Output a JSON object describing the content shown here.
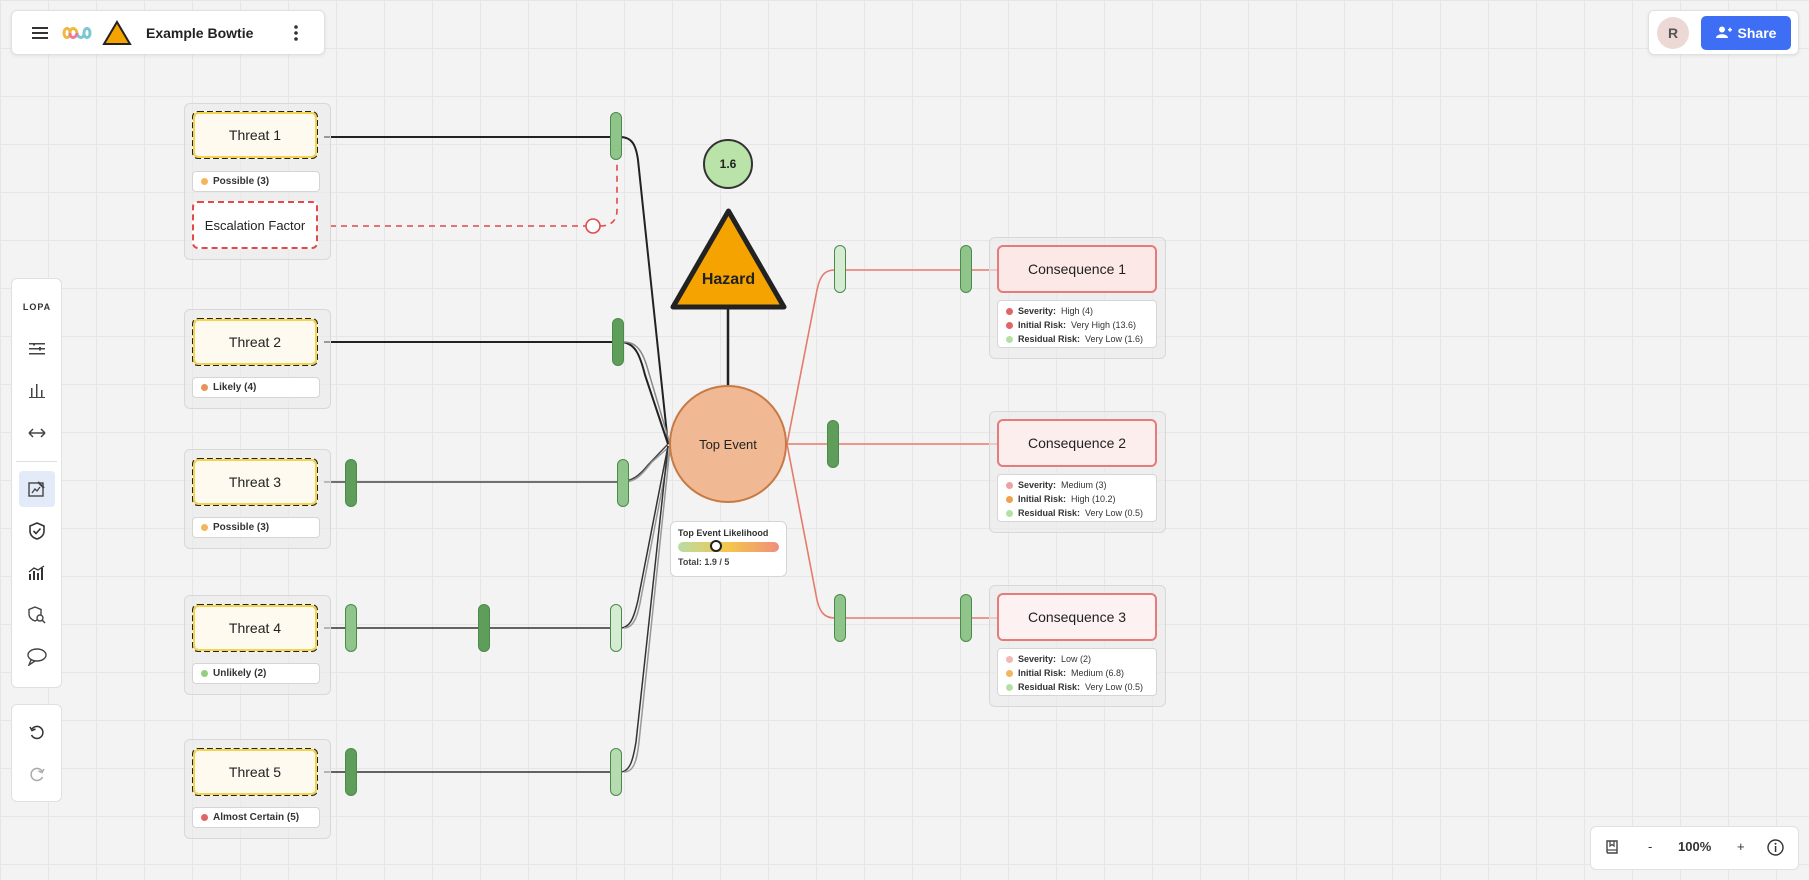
{
  "topbar": {
    "title": "Example Bowtie"
  },
  "user": {
    "initial": "R"
  },
  "share": {
    "label": "Share"
  },
  "toolbar": {
    "lopa_label": "LOPA"
  },
  "zoom": {
    "minus": "-",
    "level": "100%",
    "plus": "+"
  },
  "hazard": {
    "label": "Hazard"
  },
  "score": {
    "value": "1.6"
  },
  "top_event": {
    "label": "Top Event",
    "likelihood_title": "Top Event Likelihood",
    "likelihood_total": "Total: 1.9 / 5",
    "likelihood_value": 1.9,
    "likelihood_max": 5
  },
  "threats": [
    {
      "label": "Threat 1",
      "likelihood": "Possible (3)",
      "color": "#f4b65b"
    },
    {
      "label": "Threat 2",
      "likelihood": "Likely (4)",
      "color": "#e8935a"
    },
    {
      "label": "Threat 3",
      "likelihood": "Possible (3)",
      "color": "#f4b65b"
    },
    {
      "label": "Threat 4",
      "likelihood": "Unlikely (2)",
      "color": "#93cf7e"
    },
    {
      "label": "Threat 5",
      "likelihood": "Almost Certain (5)",
      "color": "#e06565"
    }
  ],
  "escalation": {
    "label": "Escalation Factor"
  },
  "consequences": [
    {
      "label": "Consequence 1",
      "severity_label": "Severity:",
      "severity": "High (4)",
      "severity_color": "#e06565",
      "initial_label": "Initial Risk:",
      "initial": "Very High (13.6)",
      "initial_color": "#e06565",
      "residual_label": "Residual Risk:",
      "residual": "Very Low (1.6)",
      "residual_color": "#b5e0a4"
    },
    {
      "label": "Consequence 2",
      "severity_label": "Severity:",
      "severity": "Medium (3)",
      "severity_color": "#f0a0a0",
      "initial_label": "Initial Risk:",
      "initial": "High (10.2)",
      "initial_color": "#f0a14a",
      "residual_label": "Residual Risk:",
      "residual": "Very Low (0.5)",
      "residual_color": "#b5e0a4"
    },
    {
      "label": "Consequence 3",
      "severity_label": "Severity:",
      "severity": "Low (2)",
      "severity_color": "#f4b6b6",
      "initial_label": "Initial Risk:",
      "initial": "Medium (6.8)",
      "initial_color": "#f4b65b",
      "residual_label": "Residual Risk:",
      "residual": "Very Low (0.5)",
      "residual_color": "#b5e0a4"
    }
  ]
}
